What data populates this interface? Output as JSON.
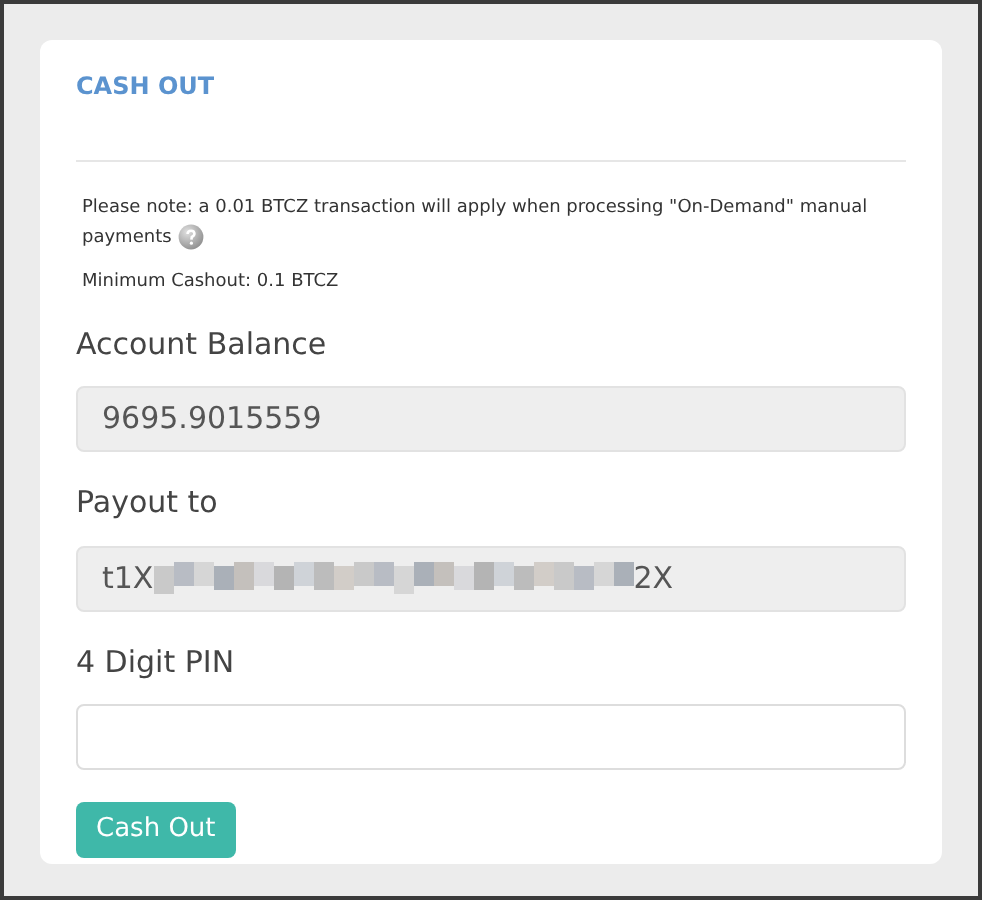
{
  "panel": {
    "title": "CASH OUT",
    "note": "Please note: a 0.01 BTCZ transaction will apply when processing \"On-Demand\" manual payments",
    "minimum": "Minimum Cashout: 0.1 BTCZ"
  },
  "fields": [
    {
      "kind": "readonly",
      "label": "Account Balance",
      "value": "9695.9015559"
    },
    {
      "kind": "redacted",
      "label": "Payout to",
      "value_start": "t1X",
      "value_end": "2X"
    },
    {
      "kind": "input",
      "label": "4 Digit PIN"
    }
  ],
  "button": "Cash Out"
}
